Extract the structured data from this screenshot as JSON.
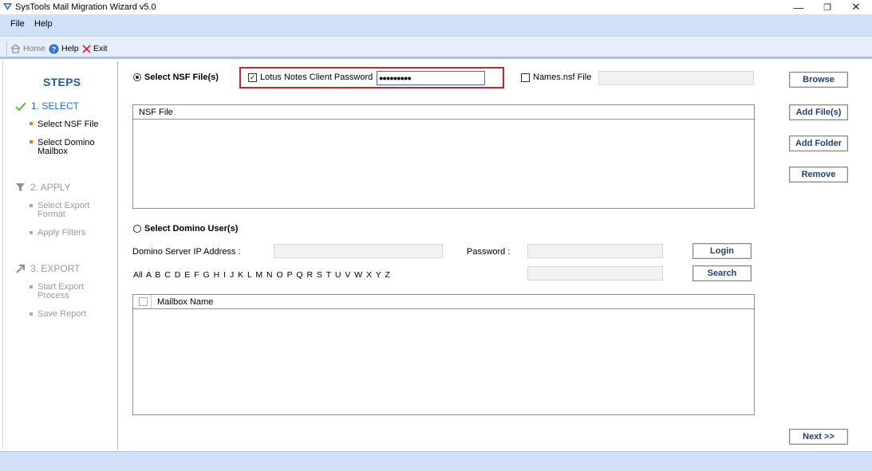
{
  "window": {
    "title": "SysTools Mail Migration Wizard v5.0",
    "minimize": "—",
    "maximize": "❐",
    "close": "✕"
  },
  "menu": {
    "file": "File",
    "help": "Help"
  },
  "toolbar": {
    "home": "Home",
    "help": "Help",
    "exit": "Exit"
  },
  "steps": {
    "title": "STEPS",
    "step1": {
      "label": "1. SELECT",
      "items": [
        "Select NSF File",
        "Select Domino\nMailbox"
      ]
    },
    "step2": {
      "label": "2. APPLY",
      "items": [
        "Select Export\nFormat",
        "Apply Filters"
      ]
    },
    "step3": {
      "label": "3. EXPORT",
      "items": [
        "Start Export\nProcess",
        "Save Report"
      ]
    }
  },
  "nsf": {
    "radio_label": "Select NSF File(s)",
    "password_check_label": "Lotus Notes Client Password",
    "password_value": "●●●●●●●●●",
    "names_check_label": "Names.nsf File",
    "names_value": "",
    "list_header": "NSF File"
  },
  "domino": {
    "radio_label": "Select Domino User(s)",
    "server_label": "Domino Server IP Address :",
    "server_value": "",
    "password_label": "Password :",
    "password_value": "",
    "search_value": "",
    "alphabet": "All  A  B  C  D  E  F  G  H  I  J  K  L  M  N  O  P  Q  R  S  T  U  V  W  X  Y  Z",
    "list_header": "Mailbox Name"
  },
  "buttons": {
    "browse": "Browse",
    "add_files": "Add File(s)",
    "add_folder": "Add Folder",
    "remove": "Remove",
    "login": "Login",
    "search": "Search",
    "next": "Next >>"
  },
  "colors": {
    "accent": "#1e5bb5",
    "highlight_border": "#d4202a",
    "step_active": "#1e6fd6",
    "step_inactive": "#9a9a9a",
    "bullet_active": "#ef7b18"
  }
}
